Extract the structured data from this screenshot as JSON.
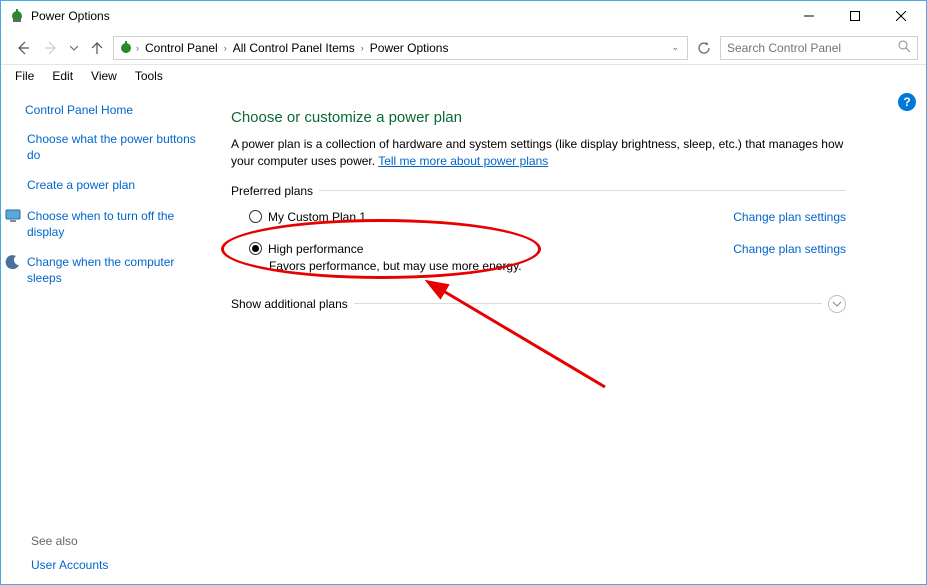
{
  "window": {
    "title": "Power Options"
  },
  "nav": {
    "breadcrumbs": [
      "Control Panel",
      "All Control Panel Items",
      "Power Options"
    ],
    "search_placeholder": "Search Control Panel"
  },
  "menu": {
    "items": [
      "File",
      "Edit",
      "View",
      "Tools"
    ]
  },
  "sidebar": {
    "home": "Control Panel Home",
    "tasks": [
      {
        "label": "Choose what the power buttons do",
        "icon": ""
      },
      {
        "label": "Create a power plan",
        "icon": ""
      },
      {
        "label": "Choose when to turn off the display",
        "icon": "monitor"
      },
      {
        "label": "Change when the computer sleeps",
        "icon": "moon"
      }
    ],
    "see_also_label": "See also",
    "see_also_link": "User Accounts"
  },
  "main": {
    "heading": "Choose or customize a power plan",
    "description_1": "A power plan is a collection of hardware and system settings (like display brightness, sleep, etc.) that manages how your computer uses power. ",
    "description_link": "Tell me more about power plans",
    "preferred_plans_label": "Preferred plans",
    "plans": [
      {
        "name": "My Custom Plan 1",
        "description": "",
        "selected": false,
        "change_label": "Change plan settings"
      },
      {
        "name": "High performance",
        "description": "Favors performance, but may use more energy.",
        "selected": true,
        "change_label": "Change plan settings"
      }
    ],
    "show_additional_label": "Show additional plans"
  },
  "help_tooltip": "?"
}
